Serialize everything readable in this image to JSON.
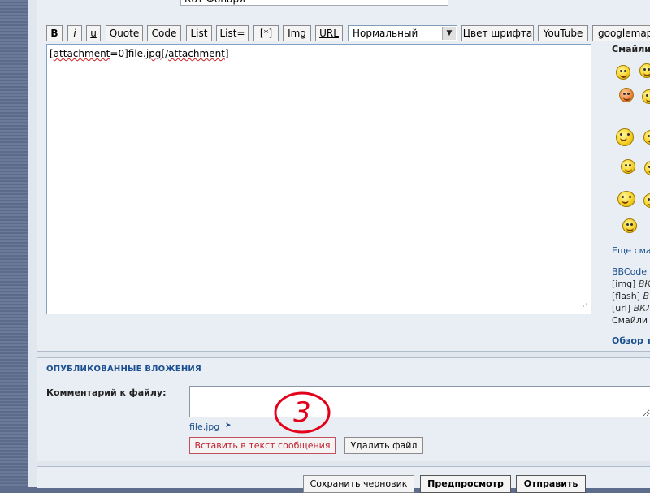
{
  "subject": {
    "value": "Кот Фонари"
  },
  "toolbar": {
    "bold": "B",
    "italic": "i",
    "underline": "u",
    "quote": "Quote",
    "code": "Code",
    "list": "List",
    "list_eq": "List=",
    "list_item": "[*]",
    "img": "Img",
    "url": "URL",
    "size_select": "Нормальный",
    "font_color": "Цвет шрифта",
    "youtube": "YouTube",
    "googlemaps": "googlemap"
  },
  "editor": {
    "parts": [
      "[",
      "attachment",
      "=0]file.",
      "jpg",
      "[/",
      "attachment",
      "]"
    ]
  },
  "smilies": {
    "title": "Смайли",
    "icons": [
      "grin-smiley-icon",
      "devil-smiley-icon",
      "blush-smiley-icon",
      "cool-smiley-icon",
      "sailing-smiley-icon",
      "mad-smiley-icon",
      "tongue-smiley-icon",
      "wink-smiley-icon",
      "hug-smiley-icon",
      "angry-smiley-icon",
      "eek-smiley-icon"
    ]
  },
  "sidebar": {
    "more_smilies": "Еще сма",
    "bbcode": "BBCode",
    "img_line": {
      "tag": "[img]",
      "val": "ВК"
    },
    "flash_line": {
      "tag": "[flash]",
      "val": "В"
    },
    "url_line": {
      "tag": "[url]",
      "val": "ВКЛ"
    },
    "smilies_line": "Смайли",
    "browse": "Обзор т"
  },
  "attachments": {
    "header": "ОПУБЛИКОВАННЫЕ ВЛОЖЕНИЯ",
    "comment_label": "Комментарий к файлу:",
    "comment_value": "",
    "filename": "file.jpg",
    "insert_button": "Вставить в текст сообщения",
    "delete_button": "Удалить файл",
    "annotation": "3"
  },
  "actions": {
    "save_draft": "Сохранить черновик",
    "preview": "Предпросмотр",
    "submit": "Отправить"
  }
}
